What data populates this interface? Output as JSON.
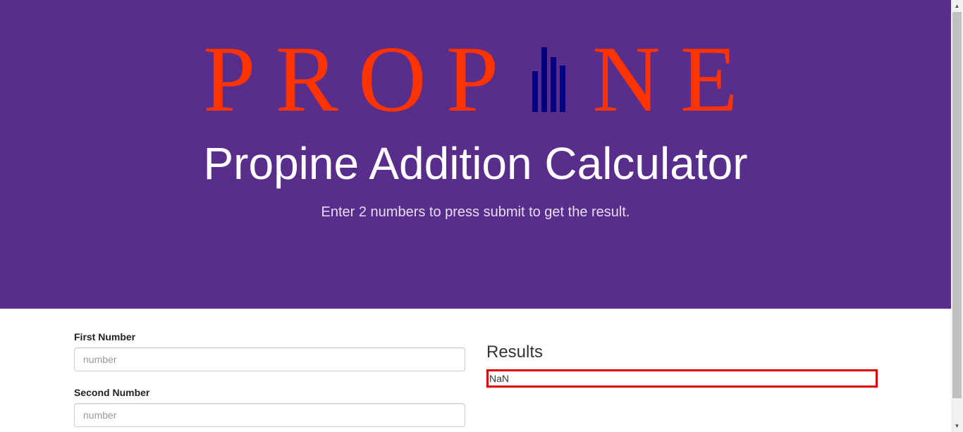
{
  "logo": {
    "left_text": "PROP",
    "right_text": "NE",
    "text_color": "#ff3300",
    "bars_color": "#000080"
  },
  "hero": {
    "title": "Propine Addition Calculator",
    "subtitle": "Enter 2 numbers to press submit to get the result.",
    "background": "#592d8c"
  },
  "form": {
    "first_label": "First Number",
    "first_placeholder": "number",
    "first_value": "",
    "second_label": "Second Number",
    "second_placeholder": "number",
    "second_value": ""
  },
  "results": {
    "title": "Results",
    "value": "NaN",
    "border_color": "#dd0000"
  }
}
